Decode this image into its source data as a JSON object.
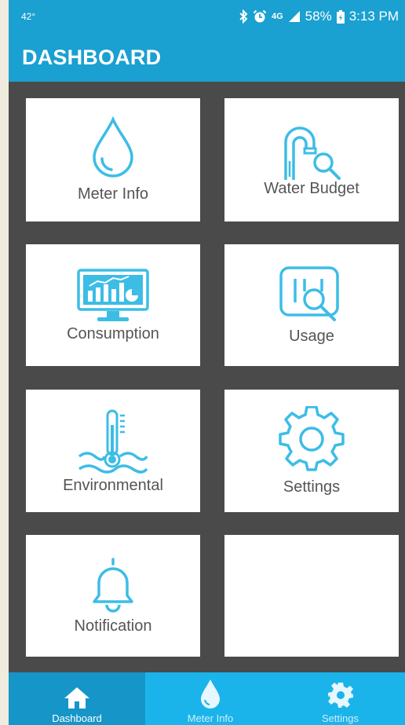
{
  "status_bar": {
    "temperature": "42°",
    "network": "4G",
    "battery": "58%",
    "time": "3:13 PM"
  },
  "app_bar": {
    "title": "DASHBOARD"
  },
  "tiles": [
    {
      "label": "Meter Info",
      "icon": "water-drop-icon"
    },
    {
      "label": "Water Budget",
      "icon": "faucet-search-icon"
    },
    {
      "label": "Consumption",
      "icon": "monitor-chart-icon"
    },
    {
      "label": "Usage",
      "icon": "meter-search-icon"
    },
    {
      "label": "Environmental",
      "icon": "thermometer-water-icon"
    },
    {
      "label": "Settings",
      "icon": "gear-icon"
    },
    {
      "label": "Notification",
      "icon": "bell-icon"
    }
  ],
  "bottom_nav": [
    {
      "label": "Dashboard",
      "icon": "home-icon",
      "active": true
    },
    {
      "label": "Meter Info",
      "icon": "water-drop-icon",
      "active": false
    },
    {
      "label": "Settings",
      "icon": "gear-icon",
      "active": false
    }
  ],
  "colors": {
    "primary": "#1aa0d1",
    "nav_bg": "#1ab4ea",
    "nav_active": "#1695c9",
    "icon_blue": "#3cbde6",
    "grid_bg": "#4a4a4a"
  }
}
